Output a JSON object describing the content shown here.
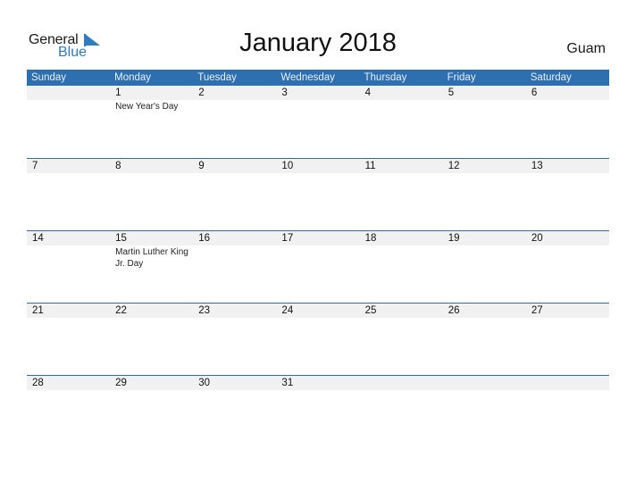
{
  "logo": {
    "line1": "General",
    "line2": "Blue",
    "brand_color": "#2e7bc4"
  },
  "title": "January 2018",
  "region": "Guam",
  "colors": {
    "header_bg": "#2e6fb0",
    "row_bg": "#f1f1f1"
  },
  "weekdays": [
    "Sunday",
    "Monday",
    "Tuesday",
    "Wednesday",
    "Thursday",
    "Friday",
    "Saturday"
  ],
  "weeks": [
    {
      "days": [
        {
          "num": "",
          "event": ""
        },
        {
          "num": "1",
          "event": "New Year's Day"
        },
        {
          "num": "2",
          "event": ""
        },
        {
          "num": "3",
          "event": ""
        },
        {
          "num": "4",
          "event": ""
        },
        {
          "num": "5",
          "event": ""
        },
        {
          "num": "6",
          "event": ""
        }
      ]
    },
    {
      "days": [
        {
          "num": "7",
          "event": ""
        },
        {
          "num": "8",
          "event": ""
        },
        {
          "num": "9",
          "event": ""
        },
        {
          "num": "10",
          "event": ""
        },
        {
          "num": "11",
          "event": ""
        },
        {
          "num": "12",
          "event": ""
        },
        {
          "num": "13",
          "event": ""
        }
      ]
    },
    {
      "days": [
        {
          "num": "14",
          "event": ""
        },
        {
          "num": "15",
          "event": "Martin Luther King Jr. Day"
        },
        {
          "num": "16",
          "event": ""
        },
        {
          "num": "17",
          "event": ""
        },
        {
          "num": "18",
          "event": ""
        },
        {
          "num": "19",
          "event": ""
        },
        {
          "num": "20",
          "event": ""
        }
      ]
    },
    {
      "days": [
        {
          "num": "21",
          "event": ""
        },
        {
          "num": "22",
          "event": ""
        },
        {
          "num": "23",
          "event": ""
        },
        {
          "num": "24",
          "event": ""
        },
        {
          "num": "25",
          "event": ""
        },
        {
          "num": "26",
          "event": ""
        },
        {
          "num": "27",
          "event": ""
        }
      ]
    },
    {
      "days": [
        {
          "num": "28",
          "event": ""
        },
        {
          "num": "29",
          "event": ""
        },
        {
          "num": "30",
          "event": ""
        },
        {
          "num": "31",
          "event": ""
        },
        {
          "num": "",
          "event": ""
        },
        {
          "num": "",
          "event": ""
        },
        {
          "num": "",
          "event": ""
        }
      ]
    }
  ]
}
